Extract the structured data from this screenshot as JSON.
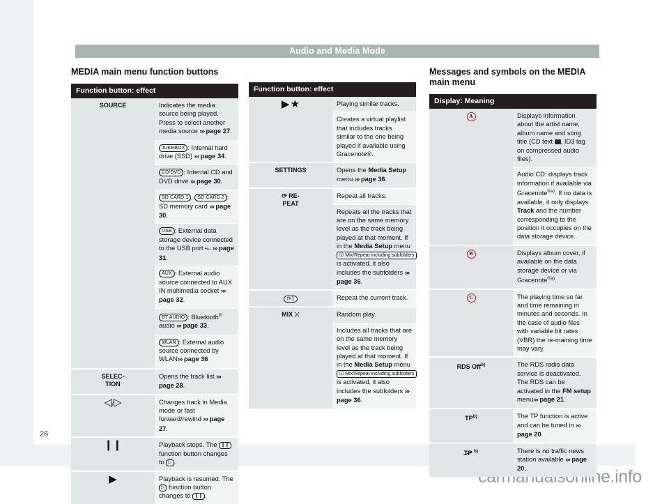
{
  "header": {
    "running_head": "Audio and Media Mode"
  },
  "footer": {
    "page_number": "26",
    "watermark": "carmanualsonline.info"
  },
  "col1": {
    "heading": "MEDIA main menu function buttons",
    "table_header": "Function button: effect",
    "rows": [
      {
        "label": "SOURCE",
        "cells": [
          "Indicates the media source being played. Press to select another media source ››› page 27.",
          "JUKEBOX: Internal hard drive (SSD) ››› page 34.",
          "CD/DVD: Internal CD and DVD drive ››› page 30.",
          "SD CARD 1, SD CARD 2: SD memory card ››› page 30.",
          "USB: External data storage device connected to the USB port ››› page 31.",
          "AUX: External audio source connected to AUX IN multimedia socket ››› page 32.",
          "BT AUDIO: Bluetooth® audio ››› page 33.",
          "WLAN: External audio source connected by WLAN ››› page 36"
        ]
      },
      {
        "label": "SELEC-TION",
        "cells": [
          "Opens the track list ››› page 28."
        ]
      },
      {
        "label": "◁ / ▷",
        "cells": [
          "Changes track in Media mode or fast forward/rewind ››› page 27."
        ]
      },
      {
        "label": "❙❙",
        "cells": [
          "Playback stops. The ❙❙ function button changes to ▷."
        ]
      },
      {
        "label": "▶",
        "cells": [
          "Playback is resumed. The ▷ function button changes to ❙❙."
        ]
      }
    ]
  },
  "col2": {
    "table_header": "Function button: effect",
    "rows": [
      {
        "label": "▶ ★",
        "cells": [
          "Playing similar tracks.",
          "Creates a virtual playlist that includes tracks similar to the one being played if available using Gracenote®."
        ]
      },
      {
        "label": "SETTINGS",
        "cells": [
          "Opens the Media Setup menu ››› page 36."
        ]
      },
      {
        "label": "⟲ RE-PEAT",
        "cells": [
          "Repeat all tracks.",
          "Repeats all the tracks that are on the same memory level as the track being played at that moment. If in the Media Setup menu Mix/Repeat including subfolders is activated, it also includes the subfolders ››› page 36."
        ]
      },
      {
        "label": "⟲1",
        "cells": [
          "Repeat the current track."
        ]
      },
      {
        "label": "MIX ⤫",
        "cells": [
          "Random play.",
          "Includes all tracks that are on the same memory level as the track being played at that moment. If in the Media Setup menu Mix/Repeat including subfolders is activated, it also includes the subfolders ››› page 36."
        ]
      }
    ]
  },
  "col3": {
    "heading": "Messages and symbols on the MEDIA main menu",
    "table_header": "Display: Meaning",
    "rows": [
      {
        "label": "A",
        "label_type": "circle",
        "cells": [
          "Displays information about the artist name, album name and song title (CD text , ID3 tag on compressed audio files).",
          "Audio CD: displays track information if available via Gracenote®a). If no data is available, it only displays Track and the number corresponding to the position it occupies on the data storage device."
        ]
      },
      {
        "label": "B",
        "label_type": "circle",
        "cells": [
          "Displays album cover, if available on the data storage device or via Gracenote®a)."
        ]
      },
      {
        "label": "C",
        "label_type": "circle",
        "cells": [
          "The playing time so far and time remaining in minutes and seconds. In the case of audio files with variable bit rates (VBR) the remaining time may vary."
        ]
      },
      {
        "label": "RDS Off",
        "label_sup": "b)",
        "cells": [
          "The RDS radio data service is deactivated. The RDS can be activated in the FM setup menu ››› page 21."
        ]
      },
      {
        "label": "TP",
        "label_sup": "b)",
        "cells": [
          "The TP function is active and can be tuned in ››› page 20."
        ]
      },
      {
        "label": "TP-struck",
        "label_sup": "b)",
        "cells": [
          "There is no traffic news station available ››› page 20."
        ]
      }
    ]
  },
  "keys": {
    "jukebox": "JUKEBOX",
    "cddvd": "CD/DVD",
    "sdcard1": "SD CARD 1",
    "sdcard2": "SD CARD 2",
    "usb": "USB",
    "aux": "AUX",
    "btaudio": "BT AUDIO",
    "wlan": "WLAN",
    "mix_repeat_subfolders": "Mix/Repeat including subfolders"
  },
  "colors": {
    "runhead_bg": "#a8b5b3",
    "table_header_bg": "#231f20",
    "circle_red": "#c8102e"
  }
}
